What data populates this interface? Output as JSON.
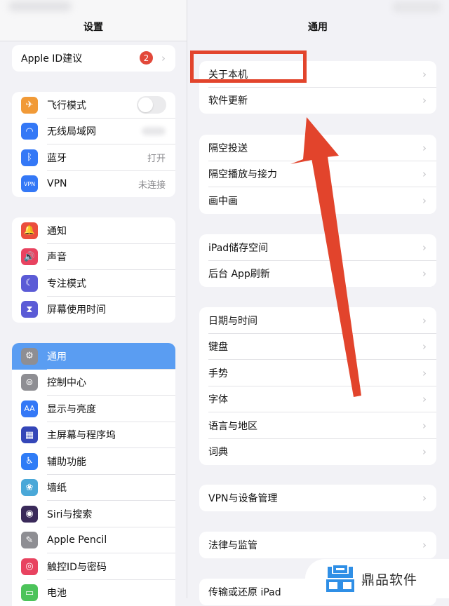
{
  "sidebar": {
    "title": "设置",
    "apple_id": {
      "label": "Apple ID建议",
      "badge": "2"
    },
    "groups": [
      [
        {
          "label": "飞行模式",
          "icon": "airplane-icon",
          "color": "#f19a37",
          "glyph": "✈",
          "accessory": "toggle",
          "toggle_on": false
        },
        {
          "label": "无线局域网",
          "icon": "wifi-icon",
          "color": "#3478f6",
          "glyph": "◠",
          "accessory": "blurred-value"
        },
        {
          "label": "蓝牙",
          "icon": "bluetooth-icon",
          "color": "#3478f6",
          "glyph": "ᛒ",
          "value": "打开"
        },
        {
          "label": "VPN",
          "icon": "vpn-icon",
          "color": "#3478f6",
          "glyph": "VPN",
          "value": "未连接"
        }
      ],
      [
        {
          "label": "通知",
          "icon": "notifications-icon",
          "color": "#eb4d3d",
          "glyph": "🔔"
        },
        {
          "label": "声音",
          "icon": "sound-icon",
          "color": "#e84360",
          "glyph": "🔊"
        },
        {
          "label": "专注模式",
          "icon": "focus-moon-icon",
          "color": "#5b5bd6",
          "glyph": "☾"
        },
        {
          "label": "屏幕使用时间",
          "icon": "screen-time-hourglass-icon",
          "color": "#5b5bd6",
          "glyph": "⧗"
        }
      ],
      [
        {
          "label": "通用",
          "icon": "gear-icon",
          "color": "#8e8e93",
          "glyph": "⚙",
          "selected": true
        },
        {
          "label": "控制中心",
          "icon": "control-center-icon",
          "color": "#8e8e93",
          "glyph": "⊜"
        },
        {
          "label": "显示与亮度",
          "icon": "display-brightness-icon",
          "color": "#3478f6",
          "glyph": "AA"
        },
        {
          "label": "主屏幕与程序坞",
          "icon": "home-screen-dock-icon",
          "color": "#3446b8",
          "glyph": "▦"
        },
        {
          "label": "辅助功能",
          "icon": "accessibility-icon",
          "color": "#2f7cf6",
          "glyph": "♿"
        },
        {
          "label": "墙纸",
          "icon": "wallpaper-icon",
          "color": "#4aa8d8",
          "glyph": "❀"
        },
        {
          "label": "Siri与搜索",
          "icon": "siri-icon",
          "color": "#3a2a5a",
          "glyph": "◉"
        },
        {
          "label": "Apple Pencil",
          "icon": "pencil-icon",
          "color": "#8e8e93",
          "glyph": "✎"
        },
        {
          "label": "触控ID与密码",
          "icon": "touch-id-fingerprint-icon",
          "color": "#e84360",
          "glyph": "◎"
        },
        {
          "label": "电池",
          "icon": "battery-icon",
          "color": "#4cc35a",
          "glyph": "▭"
        }
      ]
    ]
  },
  "detail": {
    "title": "通用",
    "groups": [
      [
        "关于本机",
        "软件更新"
      ],
      [
        "隔空投送",
        "隔空播放与接力",
        "画中画"
      ],
      [
        "iPad储存空间",
        "后台 App刷新"
      ],
      [
        "日期与时间",
        "键盘",
        "手势",
        "字体",
        "语言与地区",
        "词典"
      ],
      [
        "VPN与设备管理"
      ],
      [
        "法律与监管"
      ],
      [
        "传输或还原 iPad"
      ]
    ]
  },
  "annotation": {
    "highlighted_item": "关于本机",
    "color": "#e2442c"
  },
  "watermark": {
    "text": "鼎品软件",
    "color": "#2f8fe6"
  }
}
